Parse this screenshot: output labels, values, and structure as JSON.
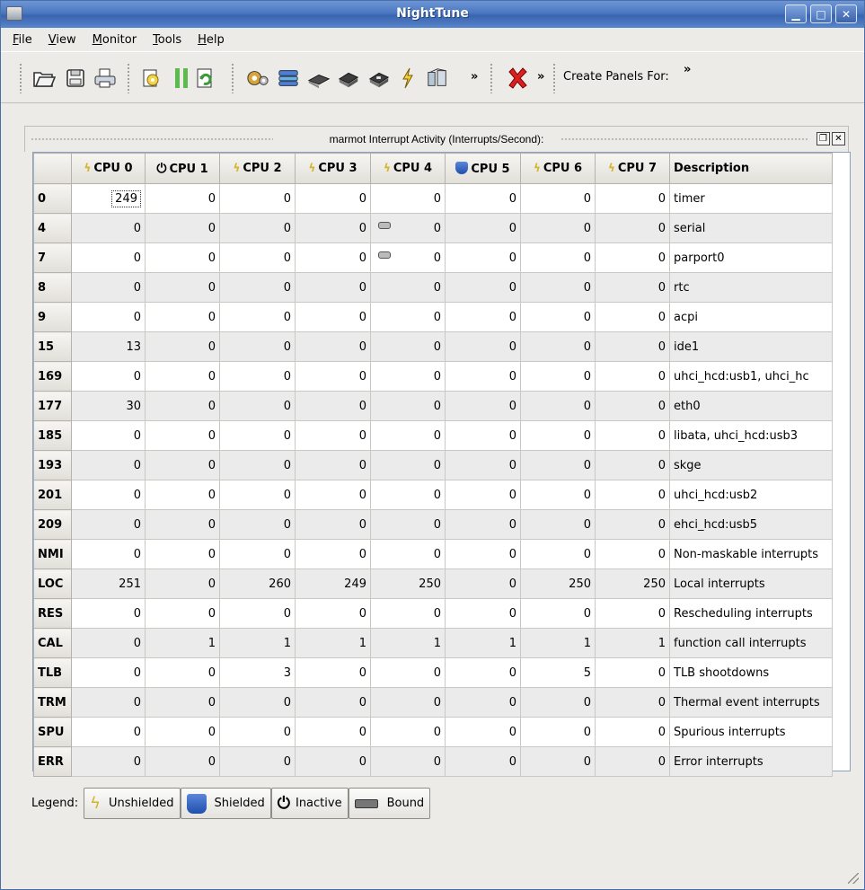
{
  "window": {
    "title": "NightTune"
  },
  "menu": [
    {
      "label": "File",
      "u": "F",
      "rest": "ile"
    },
    {
      "label": "View",
      "u": "V",
      "rest": "iew"
    },
    {
      "label": "Monitor",
      "u": "M",
      "rest": "onitor"
    },
    {
      "label": "Tools",
      "u": "T",
      "rest": "ools"
    },
    {
      "label": "Help",
      "u": "H",
      "rest": "elp"
    }
  ],
  "toolbar": {
    "more_label": "»",
    "create_panels_label": "Create Panels For:",
    "create_more_label": "»",
    "icons": [
      "open-icon",
      "save-icon",
      "print-icon",
      "settings-icon",
      "pause-icon",
      "refresh-icon",
      "processes-icon",
      "network-icon",
      "memory-icon",
      "cpu-icon",
      "cpu-shield-icon",
      "interrupt-icon",
      "filesystem-icon",
      "close-icon"
    ]
  },
  "panel": {
    "title": "marmot Interrupt Activity (Interrupts/Second):",
    "columns": [
      {
        "label": "CPU 0",
        "icon": "unshielded"
      },
      {
        "label": "CPU 1",
        "icon": "inactive"
      },
      {
        "label": "CPU 2",
        "icon": "unshielded"
      },
      {
        "label": "CPU 3",
        "icon": "unshielded"
      },
      {
        "label": "CPU 4",
        "icon": "unshielded"
      },
      {
        "label": "CPU 5",
        "icon": "shielded"
      },
      {
        "label": "CPU 6",
        "icon": "unshielded"
      },
      {
        "label": "CPU 7",
        "icon": "unshielded"
      },
      {
        "label": "Description",
        "icon": ""
      }
    ],
    "rows": [
      {
        "irq": "0",
        "values": [
          "249",
          "0",
          "0",
          "0",
          "0",
          "0",
          "0",
          "0"
        ],
        "desc": "timer"
      },
      {
        "irq": "4",
        "values": [
          "0",
          "0",
          "0",
          "0",
          "0",
          "0",
          "0",
          "0"
        ],
        "desc": "serial",
        "bound_col": 4
      },
      {
        "irq": "7",
        "values": [
          "0",
          "0",
          "0",
          "0",
          "0",
          "0",
          "0",
          "0"
        ],
        "desc": "parport0",
        "bound_col": 4
      },
      {
        "irq": "8",
        "values": [
          "0",
          "0",
          "0",
          "0",
          "0",
          "0",
          "0",
          "0"
        ],
        "desc": "rtc"
      },
      {
        "irq": "9",
        "values": [
          "0",
          "0",
          "0",
          "0",
          "0",
          "0",
          "0",
          "0"
        ],
        "desc": "acpi"
      },
      {
        "irq": "15",
        "values": [
          "13",
          "0",
          "0",
          "0",
          "0",
          "0",
          "0",
          "0"
        ],
        "desc": "ide1"
      },
      {
        "irq": "169",
        "values": [
          "0",
          "0",
          "0",
          "0",
          "0",
          "0",
          "0",
          "0"
        ],
        "desc": "uhci_hcd:usb1, uhci_hc"
      },
      {
        "irq": "177",
        "values": [
          "30",
          "0",
          "0",
          "0",
          "0",
          "0",
          "0",
          "0"
        ],
        "desc": "eth0"
      },
      {
        "irq": "185",
        "values": [
          "0",
          "0",
          "0",
          "0",
          "0",
          "0",
          "0",
          "0"
        ],
        "desc": "libata, uhci_hcd:usb3"
      },
      {
        "irq": "193",
        "values": [
          "0",
          "0",
          "0",
          "0",
          "0",
          "0",
          "0",
          "0"
        ],
        "desc": "skge"
      },
      {
        "irq": "201",
        "values": [
          "0",
          "0",
          "0",
          "0",
          "0",
          "0",
          "0",
          "0"
        ],
        "desc": "uhci_hcd:usb2"
      },
      {
        "irq": "209",
        "values": [
          "0",
          "0",
          "0",
          "0",
          "0",
          "0",
          "0",
          "0"
        ],
        "desc": "ehci_hcd:usb5"
      },
      {
        "irq": "NMI",
        "values": [
          "0",
          "0",
          "0",
          "0",
          "0",
          "0",
          "0",
          "0"
        ],
        "desc": "Non-maskable interrupts"
      },
      {
        "irq": "LOC",
        "values": [
          "251",
          "0",
          "260",
          "249",
          "250",
          "0",
          "250",
          "250"
        ],
        "desc": "Local interrupts"
      },
      {
        "irq": "RES",
        "values": [
          "0",
          "0",
          "0",
          "0",
          "0",
          "0",
          "0",
          "0"
        ],
        "desc": "Rescheduling interrupts"
      },
      {
        "irq": "CAL",
        "values": [
          "0",
          "1",
          "1",
          "1",
          "1",
          "1",
          "1",
          "1"
        ],
        "desc": "function call interrupts"
      },
      {
        "irq": "TLB",
        "values": [
          "0",
          "0",
          "3",
          "0",
          "0",
          "0",
          "5",
          "0"
        ],
        "desc": "TLB shootdowns"
      },
      {
        "irq": "TRM",
        "values": [
          "0",
          "0",
          "0",
          "0",
          "0",
          "0",
          "0",
          "0"
        ],
        "desc": "Thermal event interrupts"
      },
      {
        "irq": "SPU",
        "values": [
          "0",
          "0",
          "0",
          "0",
          "0",
          "0",
          "0",
          "0"
        ],
        "desc": "Spurious interrupts"
      },
      {
        "irq": "ERR",
        "values": [
          "0",
          "0",
          "0",
          "0",
          "0",
          "0",
          "0",
          "0"
        ],
        "desc": "Error interrupts"
      }
    ]
  },
  "legend": {
    "label": "Legend:",
    "items": [
      {
        "label": "Unshielded",
        "icon": "unshielded"
      },
      {
        "label": "Shielded",
        "icon": "shielded"
      },
      {
        "label": "Inactive",
        "icon": "inactive"
      },
      {
        "label": "Bound",
        "icon": "bound"
      }
    ]
  },
  "colors": {
    "titlebar": "#4a77c0",
    "unshielded": "#d4b52a",
    "shielded": "#2a5bbf",
    "row_alt": "#ebebeb"
  }
}
